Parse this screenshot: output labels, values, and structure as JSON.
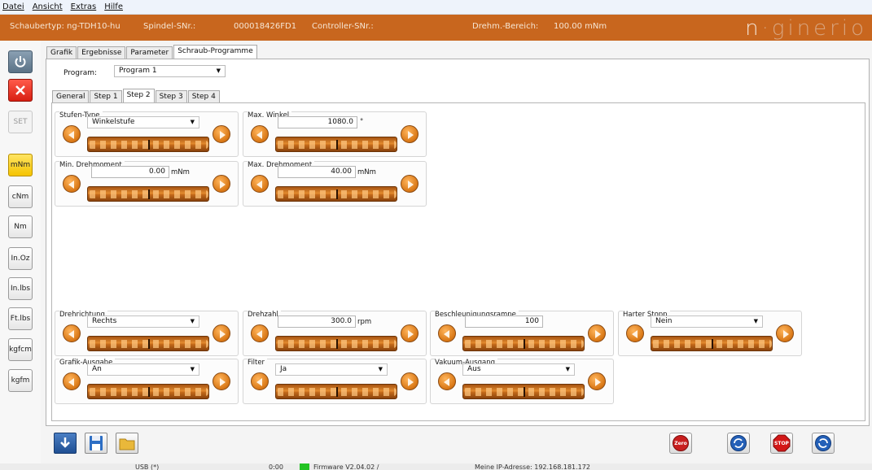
{
  "menu": [
    "Datei",
    "Ansicht",
    "Extras",
    "Hilfe"
  ],
  "header": {
    "schraubertyp_label": "Schaubertyp:",
    "schraubertyp_value": "ng-TDH10-hu",
    "spindel_label": "Spindel-SNr.:",
    "spindel_value": "000018426FD1",
    "controller_label": "Controller-SNr.:",
    "bereich_label": "Drehm.-Bereich:",
    "bereich_value": "100.00 mNm",
    "logo_a": "n",
    "logo_b": "ginerio"
  },
  "sidebar": {
    "set": "SET",
    "units": [
      "mNm",
      "cNm",
      "Nm",
      "In.Oz",
      "In.lbs",
      "Ft.lbs",
      "kgfcm",
      "kgfm"
    ],
    "selected_unit": "mNm"
  },
  "tabs": [
    "Grafik",
    "Ergebnisse",
    "Parameter",
    "Schraub-Programme"
  ],
  "active_tab": "Schraub-Programme",
  "program": {
    "label": "Program:",
    "value": "Program 1"
  },
  "steps": [
    "General",
    "Step 1",
    "Step 2",
    "Step 3",
    "Step 4"
  ],
  "active_step": "Step 2",
  "groups": {
    "stufen_type": {
      "label": "Stufen-Type",
      "value": "Winkelstufe"
    },
    "max_winkel": {
      "label": "Max. Winkel",
      "value": "1080.0",
      "unit": "°"
    },
    "min_drehmoment": {
      "label": "Min. Drehmoment",
      "value": "0.00",
      "unit": "mNm"
    },
    "max_drehmoment": {
      "label": "Max. Drehmoment",
      "value": "40.00",
      "unit": "mNm"
    },
    "drehrichtung": {
      "label": "Drehrichtung",
      "value": "Rechts"
    },
    "drehzahl": {
      "label": "Drehzahl",
      "value": "300.0",
      "unit": "rpm"
    },
    "beschleunigung": {
      "label": "Beschleunigungsrampe",
      "value": "100"
    },
    "harter_stopp": {
      "label": "Harter Stopp",
      "value": "Nein"
    },
    "grafik_ausgabe": {
      "label": "Grafik-Ausgabe",
      "value": "An"
    },
    "filter": {
      "label": "Filter",
      "value": "Ja"
    },
    "vakuum": {
      "label": "Vakuum-Ausgang",
      "value": "Aus"
    }
  },
  "buttons": {
    "zero": "Zero",
    "stop": "STOP"
  },
  "status": {
    "usb": "USB (*)",
    "time": "0:00",
    "firmware": "Firmware V2.04.02 /",
    "ip": "Meine IP-Adresse: 192.168.181.172"
  },
  "colors": {
    "header_bg": "#c8661e",
    "selected_unit_bg": "#f5c400",
    "firmware_ok": "#22c322"
  }
}
